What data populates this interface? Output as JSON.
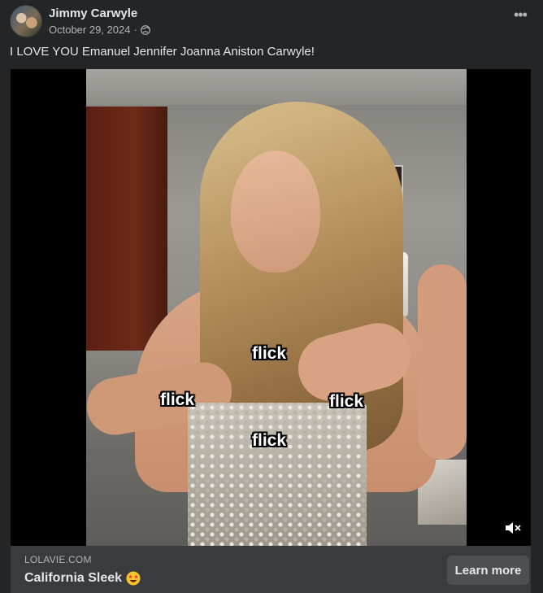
{
  "post": {
    "author": "Jimmy Carwyle",
    "date": "October 29, 2024",
    "date_separator": "·",
    "audience_icon": "globe-icon",
    "more_icon": "more-options-icon",
    "text": "I LOVE YOU Emanuel Jennifer Joanna Aniston Carwyle!"
  },
  "video": {
    "captions": [
      "flick",
      "flick",
      "flick",
      "flick"
    ],
    "mute_icon": "speaker-muted-icon"
  },
  "ad": {
    "domain": "LOLAVIE.COM",
    "title": "California Sleek",
    "title_emoji_icon": "star-struck-emoji-icon",
    "cta_label": "Learn more"
  },
  "colors": {
    "background": "#242526",
    "footer": "#3a3b3c",
    "text_primary": "#e4e6eb",
    "text_secondary": "#b0b3b8"
  }
}
